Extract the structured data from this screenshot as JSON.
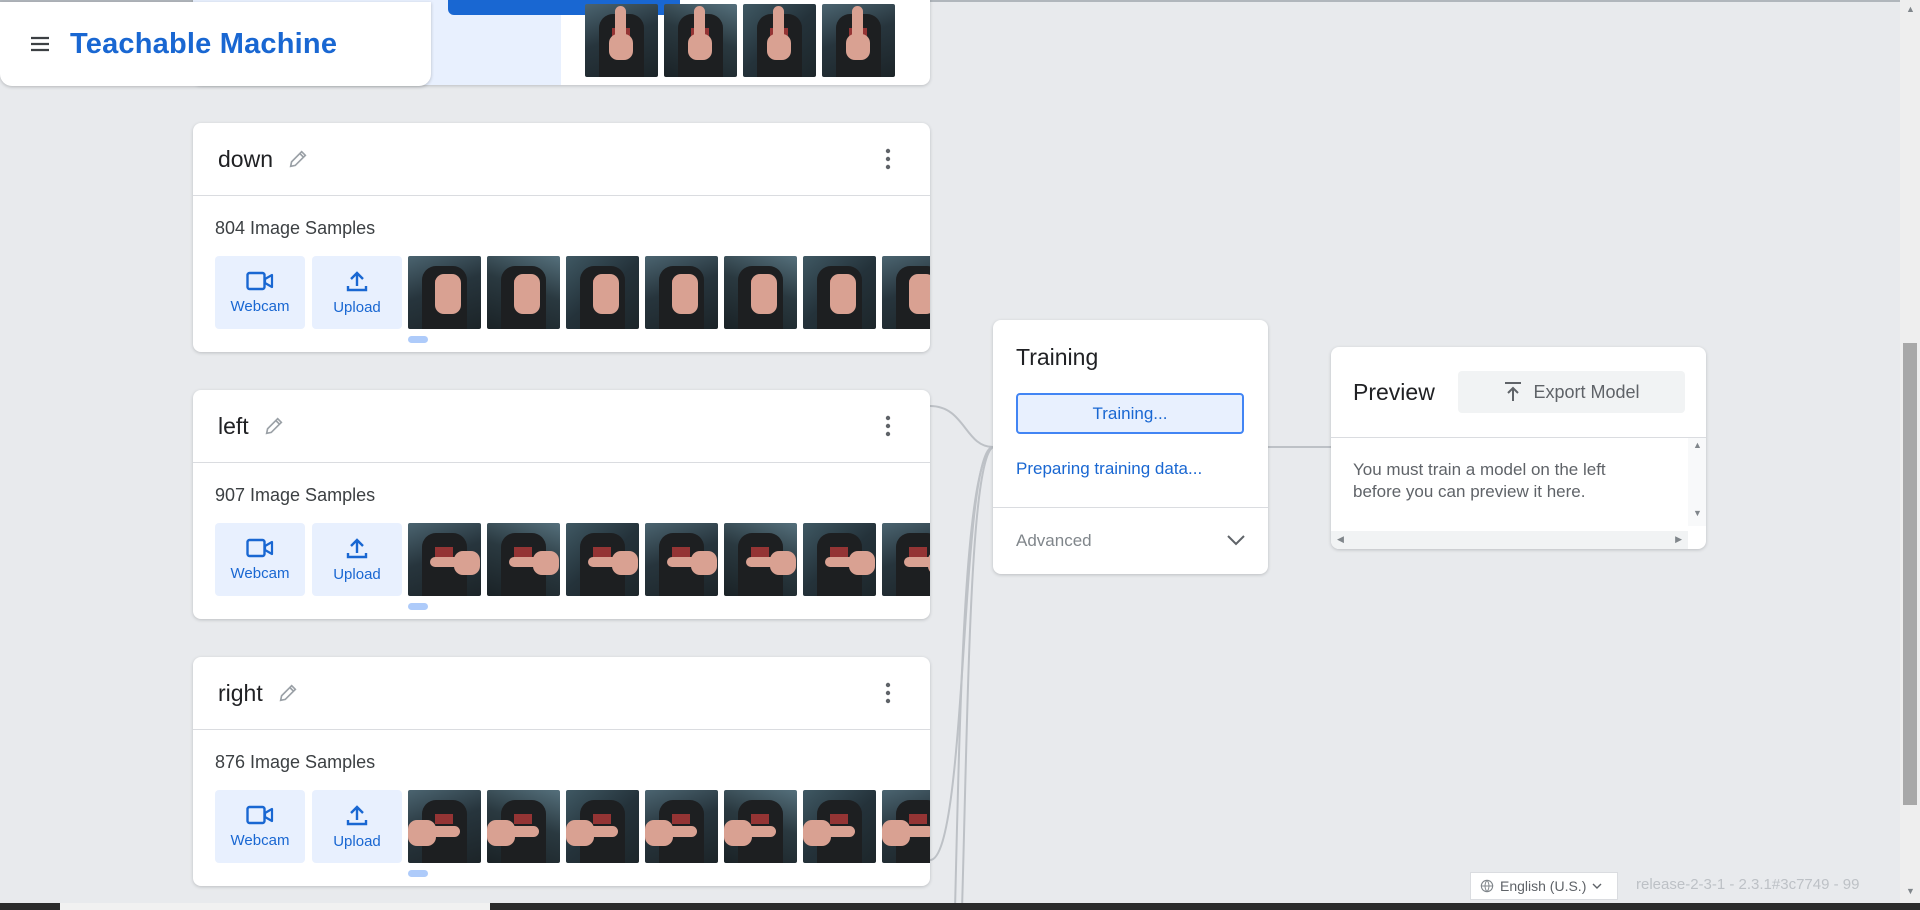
{
  "app": {
    "title": "Teachable Machine"
  },
  "classes": [
    {
      "name": "down",
      "samples": "804 Image Samples",
      "webcam": "Webcam",
      "upload": "Upload"
    },
    {
      "name": "left",
      "samples": "907 Image Samples",
      "webcam": "Webcam",
      "upload": "Upload"
    },
    {
      "name": "right",
      "samples": "876 Image Samples",
      "webcam": "Webcam",
      "upload": "Upload"
    }
  ],
  "training": {
    "title": "Training",
    "button": "Training...",
    "status": "Preparing training data...",
    "advanced": "Advanced"
  },
  "preview": {
    "title": "Preview",
    "export": "Export Model",
    "message": "You must train a model on the left before you can preview it here."
  },
  "footer": {
    "language": "English (U.S.)",
    "version": "release-2-3-1 - 2.3.1#3c7749 - 99"
  },
  "colors": {
    "accent": "#1967d2",
    "accent_light": "#e8f0fe",
    "background": "#e8eaed"
  },
  "icons": [
    "menu-icon",
    "pencil-icon",
    "more-vert-icon",
    "videocam-icon",
    "upload-icon",
    "chevron-down-icon",
    "export-icon",
    "globe-icon"
  ]
}
